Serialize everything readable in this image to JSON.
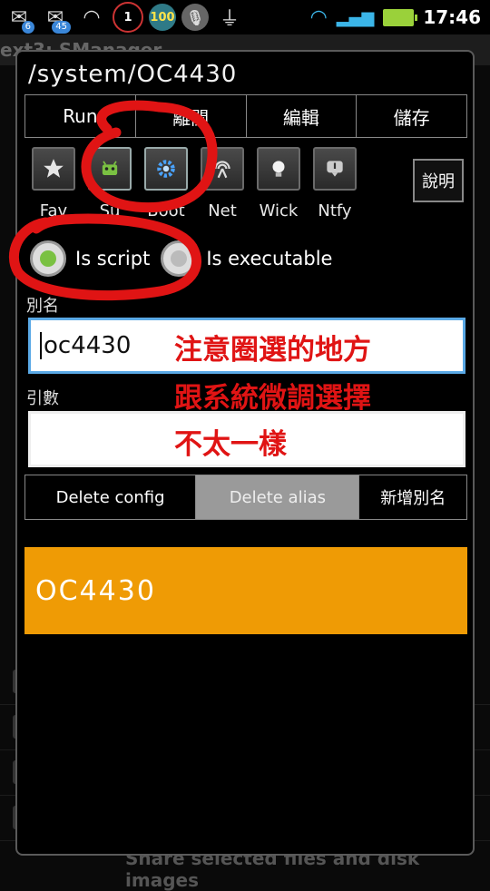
{
  "status_bar": {
    "notifications": [
      {
        "icon": "mail-icon",
        "badge": "6"
      },
      {
        "icon": "mail-icon",
        "badge": "45"
      },
      {
        "icon": "speedometer-icon",
        "badge": ""
      },
      {
        "icon": "alarm-icon",
        "badge": "1"
      },
      {
        "icon": "battery-percent-icon",
        "badge": "100"
      },
      {
        "icon": "microphone-icon",
        "badge": ""
      },
      {
        "icon": "usb-icon",
        "badge": ""
      }
    ],
    "time": "17:46"
  },
  "background_app": {
    "title": "ext3: SManager",
    "bottom_text": "Share selected files and disk images"
  },
  "dialog": {
    "title": "/system/OC4430",
    "tabs": [
      "Run",
      "離開",
      "編輯",
      "儲存"
    ],
    "categories": [
      {
        "label": "Fav",
        "icon": "star-icon"
      },
      {
        "label": "Su",
        "icon": "android-icon"
      },
      {
        "label": "Boot",
        "icon": "gear-icon"
      },
      {
        "label": "Net",
        "icon": "antenna-icon"
      },
      {
        "label": "Wick",
        "icon": "lightbulb-icon"
      },
      {
        "label": "Ntfy",
        "icon": "notify-icon"
      }
    ],
    "help_label": "說明",
    "radio_script_label": "Is script",
    "radio_exec_label": "Is executable",
    "alias_label": "別名",
    "alias_value": "oc4430",
    "args_label": "引數",
    "args_value": "",
    "delete_config_label": "Delete config",
    "delete_alias_label": "Delete alias",
    "add_alias_label": "新增別名",
    "alias_bar_text": "OC4430"
  },
  "annotation": {
    "line1": "注意圈選的地方",
    "line2": "跟系統微調選擇",
    "line3": "不太一樣",
    "color": "#e01414"
  }
}
